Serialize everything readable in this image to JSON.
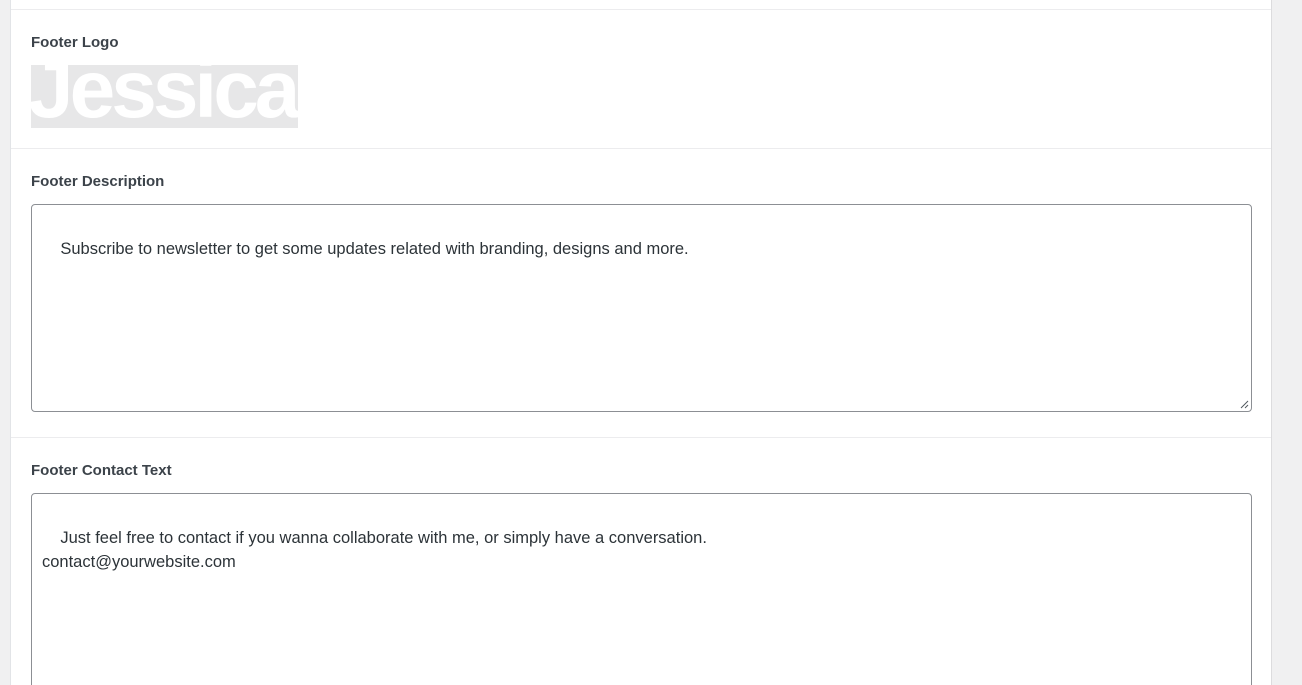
{
  "footer_logo": {
    "label": "Footer Logo",
    "logo_text": "Jessica."
  },
  "footer_description": {
    "label": "Footer Description",
    "value": "Subscribe to newsletter to get some updates related with branding, designs and more."
  },
  "footer_contact": {
    "label": "Footer Contact Text",
    "value": "Just feel free to contact if you wanna collaborate with me, or simply have a conversation.\ncontact@yourwebsite.com"
  },
  "colors": {
    "page_background": "#f0f0f1",
    "panel_background": "#ffffff",
    "label_text": "#3c434a",
    "input_border": "#8c8f94"
  }
}
